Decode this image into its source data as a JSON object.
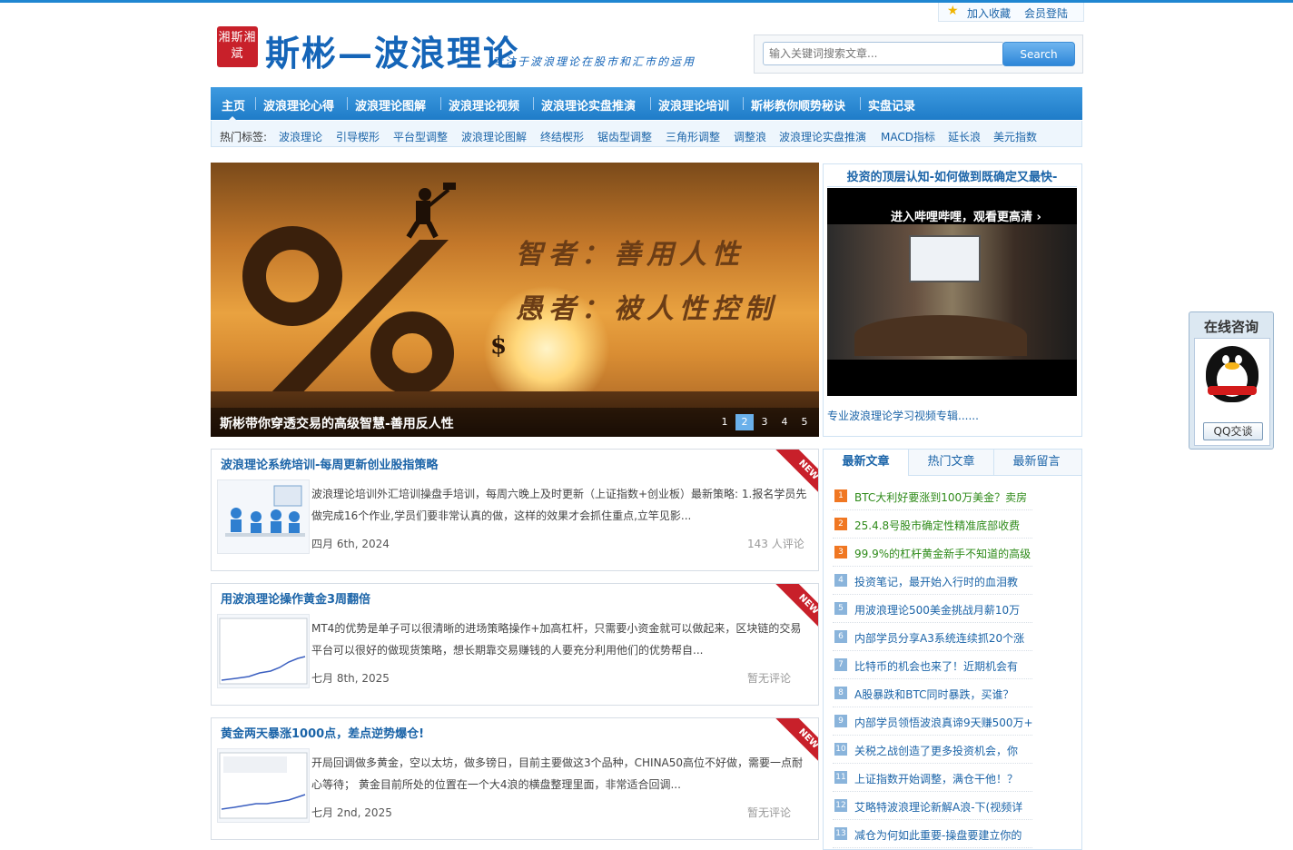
{
  "header": {
    "toplinks": {
      "favorite": "加入收藏",
      "login": "会员登陆"
    },
    "seal_text": "湘斯湘斌",
    "site_title": "斯彬—波浪理论",
    "site_subtitle": "专注于波浪理论在股市和汇市的运用",
    "search": {
      "placeholder": "输入关键词搜索文章...",
      "button": "Search"
    }
  },
  "nav": {
    "items": [
      "主页",
      "波浪理论心得",
      "波浪理论图解",
      "波浪理论视频",
      "波浪理论实盘推演",
      "波浪理论培训",
      "斯彬教你顺势秘诀",
      "实盘记录"
    ]
  },
  "tags": {
    "label": "热门标签:",
    "items": [
      "波浪理论",
      "引导楔形",
      "平台型调整",
      "波浪理论图解",
      "终结楔形",
      "锯齿型调整",
      "三角形调整",
      "调整浪",
      "波浪理论实盘推演",
      "MACD指标",
      "延长浪",
      "美元指数"
    ]
  },
  "slider": {
    "quote1": "智者：善用人性",
    "quote2": "愚者：被人性控制",
    "caption": "斯彬带你穿透交易的高级智慧-善用反人性",
    "dots": [
      "1",
      "2",
      "3",
      "4",
      "5"
    ],
    "active_dot": "2"
  },
  "video": {
    "title": "投资的顶层认知-如何做到既确定又最快-",
    "overlay": "进入哔哩哔哩，观看更高清 ›",
    "link": "专业波浪理论学习视频专辑......"
  },
  "articles": [
    {
      "title": "波浪理论系统培训-每周更新创业股指策略",
      "excerpt": "波浪理论培训外汇培训操盘手培训，每周六晚上及时更新（上证指数+创业板）最新策略: 1.报名学员先做完成16个作业,学员们要非常认真的做，这样的效果才会抓住重点,立竿见影...",
      "date": "四月 6th, 2024",
      "comments": "143 人评论",
      "badge": "NEW"
    },
    {
      "title": "用波浪理论操作黄金3周翻倍",
      "excerpt": "MT4的优势是单子可以很清晰的进场策略操作+加高杠杆，只需要小资金就可以做起来，区块链的交易平台可以很好的做现货策略，想长期靠交易赚钱的人要充分利用他们的优势帮自...",
      "date": "七月 8th, 2025",
      "comments": "暂无评论",
      "badge": "NEW"
    },
    {
      "title": "黄金两天暴涨1000点，差点逆势爆仓!",
      "excerpt": "开局回调做多黄金，空以太坊，做多镑日，目前主要做这3个品种，CHINA50高位不好做，需要一点耐心等待； 黄金目前所处的位置在一个大4浪的横盘整理里面，非常适合回调...",
      "date": "七月 2nd, 2025",
      "comments": "暂无评论",
      "badge": "NEW"
    }
  ],
  "sidebar": {
    "tabs": [
      "最新文章",
      "热门文章",
      "最新留言"
    ],
    "items": [
      "BTC大利好要涨到100万美金？卖房",
      "25.4.8号股市确定性精准底部收费",
      "99.9%的杠杆黄金新手不知道的高级",
      "投资笔记，最开始入行时的血泪教",
      "用波浪理论500美金挑战月薪10万",
      "内部学员分享A3系统连续抓20个涨",
      "比特币的机会也来了！近期机会有",
      "A股暴跌和BTC同时暴跌，买谁？",
      "内部学员领悟波浪真谛9天赚500万+",
      "关税之战创造了更多投资机会，你",
      "上证指数开始调整，满仓干他！？",
      "艾略特波浪理论新解A浪-下(视频详",
      "减仓为何如此重要-操盘要建立你的"
    ],
    "numbers": [
      "1",
      "2",
      "3",
      "4",
      "5",
      "6",
      "7",
      "8",
      "9",
      "10",
      "11",
      "12",
      "13"
    ]
  },
  "qq": {
    "title": "在线咨询",
    "button": "QQ交谈"
  },
  "colors": {
    "accent": "#1f86d1",
    "link": "#1b64a8",
    "hot": "#f07722",
    "badge": "#c8202a"
  }
}
